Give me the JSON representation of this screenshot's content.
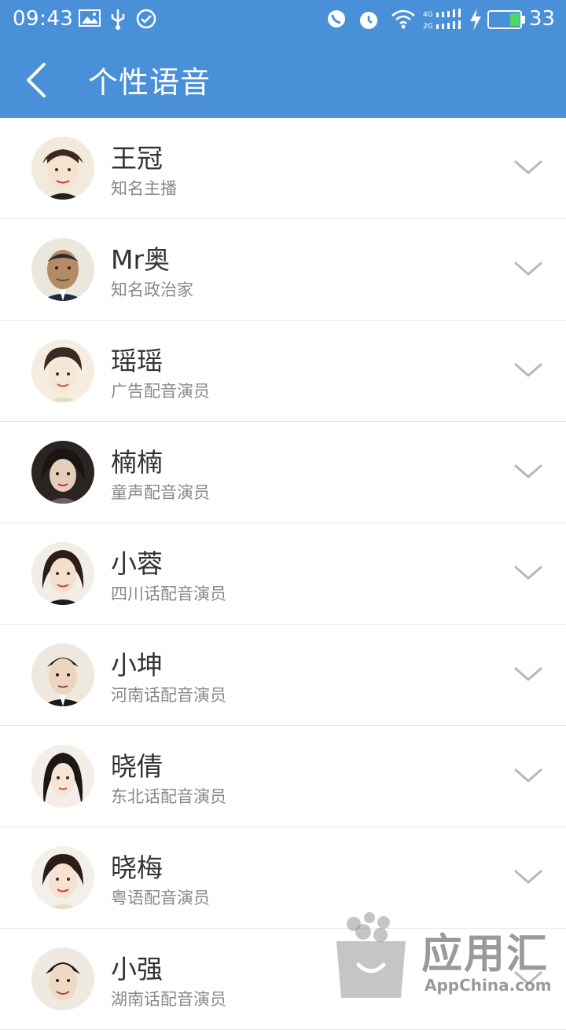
{
  "status_bar": {
    "time": "09:43",
    "battery": "33",
    "left_icons": [
      "image-icon",
      "usb-icon",
      "check-circle-icon"
    ],
    "right_icons": [
      "phone-icon",
      "alarm-icon",
      "wifi-icon",
      "signal-icon",
      "charging-icon",
      "battery-icon"
    ]
  },
  "header": {
    "title": "个性语音",
    "back_icon": "back-arrow-icon",
    "color": "#4a90d9"
  },
  "voices": [
    {
      "name": "王冠",
      "desc": "知名主播"
    },
    {
      "name": "Mr奥",
      "desc": "知名政治家"
    },
    {
      "name": "瑶瑶",
      "desc": "广告配音演员"
    },
    {
      "name": "楠楠",
      "desc": "童声配音演员"
    },
    {
      "name": "小蓉",
      "desc": "四川话配音演员"
    },
    {
      "name": "小坤",
      "desc": "河南话配音演员"
    },
    {
      "name": "晓倩",
      "desc": "东北话配音演员"
    },
    {
      "name": "晓梅",
      "desc": "粤语配音演员"
    },
    {
      "name": "小强",
      "desc": "湖南话配音演员"
    }
  ],
  "watermark": {
    "title": "应用汇",
    "subtitle": "AppChina.com"
  }
}
